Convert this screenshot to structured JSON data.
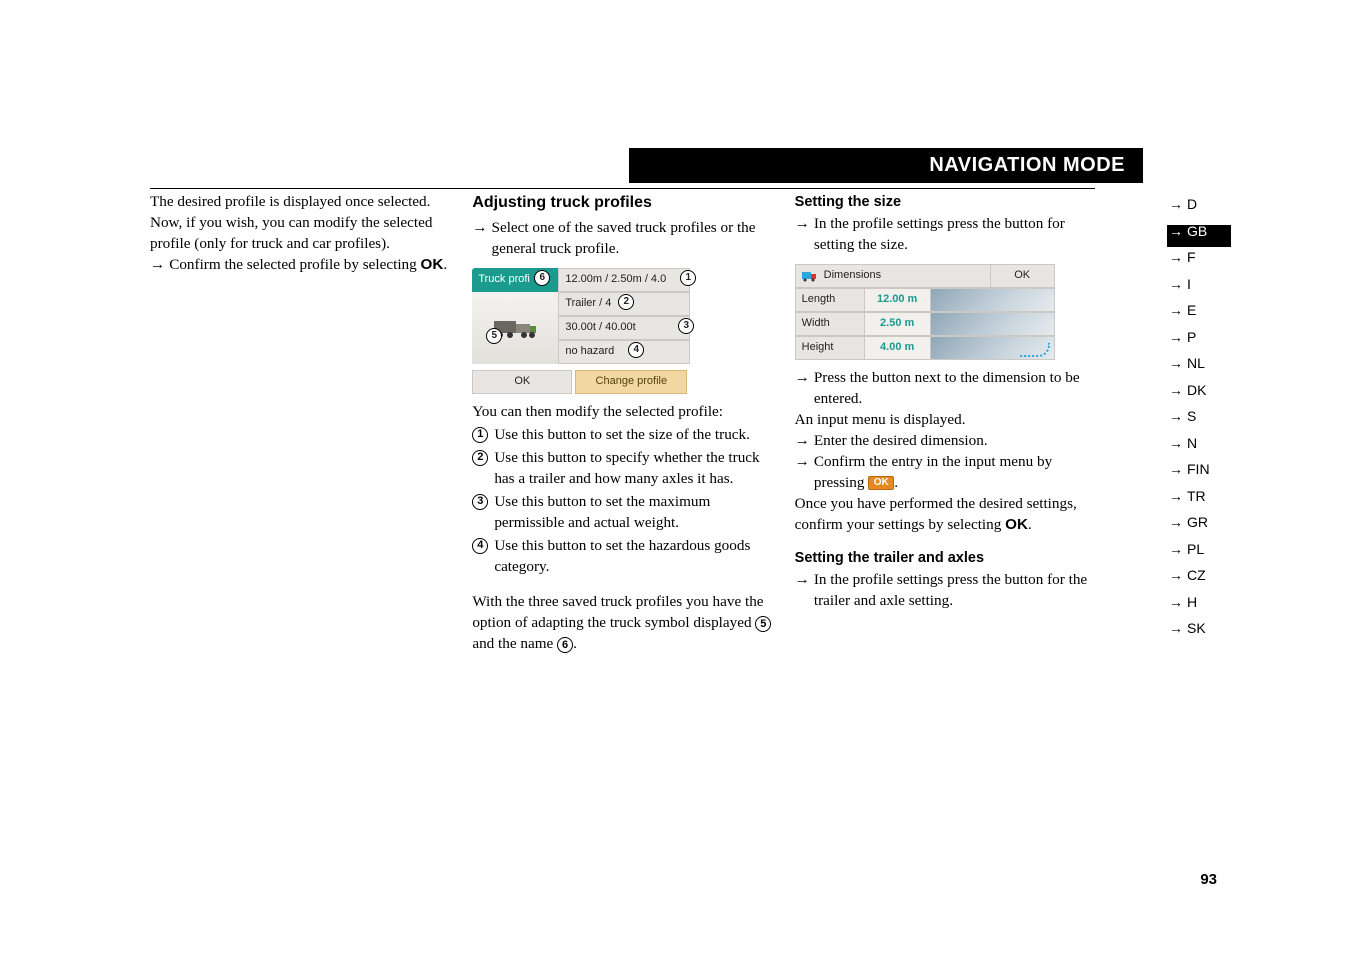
{
  "header": {
    "title": "NAVIGATION MODE",
    "arrows": "→→→"
  },
  "col1": {
    "p1": "The desired profile is displayed once selected.",
    "p2": "Now, if you wish, you can modify the selected profile (only for truck and car profiles).",
    "step_confirm_a": "Confirm the selected profile by selecting ",
    "step_confirm_b": "OK",
    "step_confirm_c": "."
  },
  "col2": {
    "h3": "Adjusting truck profiles",
    "step_select": "Select one of the saved truck profiles or the general truck profile.",
    "shot": {
      "tab": "Truck profi",
      "c1": "12.00m / 2.50m / 4.0",
      "c2": "Trailer / 4",
      "c3": "30.00t / 40.00t",
      "c4": "no hazard",
      "ok": "OK",
      "change": "Change profile"
    },
    "p_modify": "You can then modify the selected profile:",
    "n1": "Use this button to set the size of the truck.",
    "n2": "Use this button to specify whether the truck has a trailer and how many axles it has.",
    "n3": "Use this button to set the maximum permissible and actual weight.",
    "n4": "Use this button to set the hazardous goods category.",
    "p_opt_a": "With the three saved truck profiles you have the option of adapting the truck symbol displayed ",
    "p_opt_b": " and the name ",
    "p_opt_c": "."
  },
  "col3": {
    "h4a": "Setting the size",
    "s1": "In the profile settings press the button for setting the size.",
    "shot": {
      "title": "Dimensions",
      "ok": "OK",
      "rows": [
        {
          "lbl": "Length",
          "val": "12.00 m"
        },
        {
          "lbl": "Width",
          "val": "2.50 m"
        },
        {
          "lbl": "Height",
          "val": "4.00 m"
        }
      ]
    },
    "s2": "Press the button next to the dimension to be entered.",
    "p_input": "An input menu is displayed.",
    "s3": "Enter the desired dimension.",
    "s4a": "Confirm the entry in the input menu by pressing ",
    "s4b": ".",
    "p_once_a": "Once you have performed the desired settings, confirm your settings by selecting ",
    "p_once_b": "OK",
    "p_once_c": ".",
    "h4b": "Setting the trailer and axles",
    "s5": "In the profile settings press the button for the trailer and axle setting."
  },
  "sidebar": [
    "D",
    "GB",
    "F",
    "I",
    "E",
    "P",
    "NL",
    "DK",
    "S",
    "N",
    "FIN",
    "TR",
    "GR",
    "PL",
    "CZ",
    "H",
    "SK"
  ],
  "ok_pill": "OK",
  "pagenum": "93"
}
